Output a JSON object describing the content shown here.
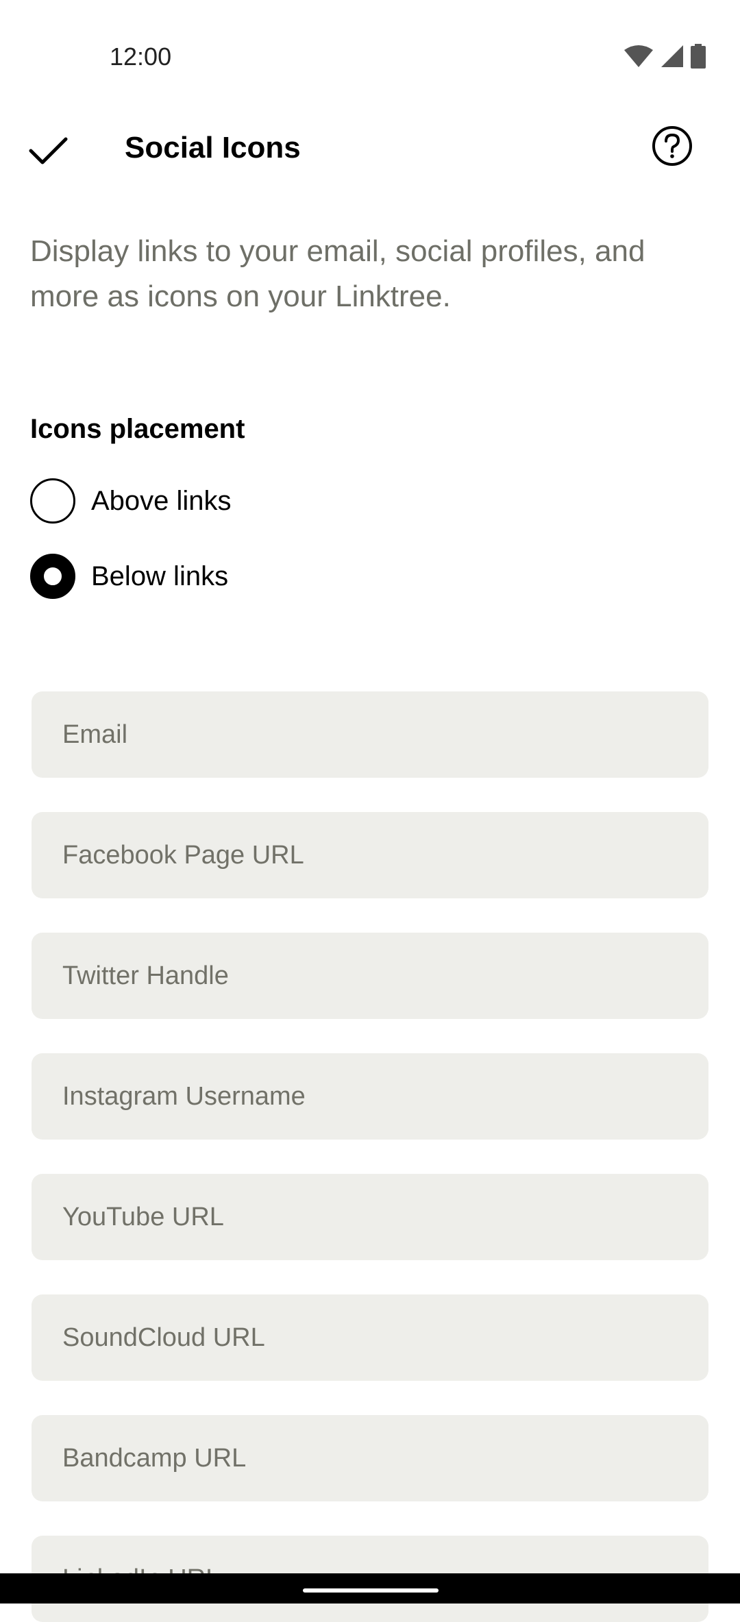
{
  "status_bar": {
    "time": "12:00",
    "icons": [
      "wifi-icon",
      "signal-icon",
      "battery-icon"
    ]
  },
  "app_bar": {
    "confirm_icon": "check-icon",
    "title": "Social Icons",
    "help_icon": "help-icon"
  },
  "description": "Display links to your email, social profiles, and more as icons on your Linktree.",
  "placement": {
    "title": "Icons placement",
    "options": [
      {
        "label": "Above links",
        "selected": false
      },
      {
        "label": "Below links",
        "selected": true
      }
    ]
  },
  "fields": [
    {
      "placeholder": "Email",
      "value": ""
    },
    {
      "placeholder": "Facebook Page URL",
      "value": ""
    },
    {
      "placeholder": "Twitter Handle",
      "value": ""
    },
    {
      "placeholder": "Instagram Username",
      "value": ""
    },
    {
      "placeholder": "YouTube URL",
      "value": ""
    },
    {
      "placeholder": "SoundCloud URL",
      "value": ""
    },
    {
      "placeholder": "Bandcamp URL",
      "value": ""
    },
    {
      "placeholder": "LinkedIn URL",
      "value": ""
    }
  ],
  "colors": {
    "field_background": "#eeeeea",
    "placeholder_text": "#717168",
    "description_text": "#6e6f67",
    "accent": "#000000"
  }
}
